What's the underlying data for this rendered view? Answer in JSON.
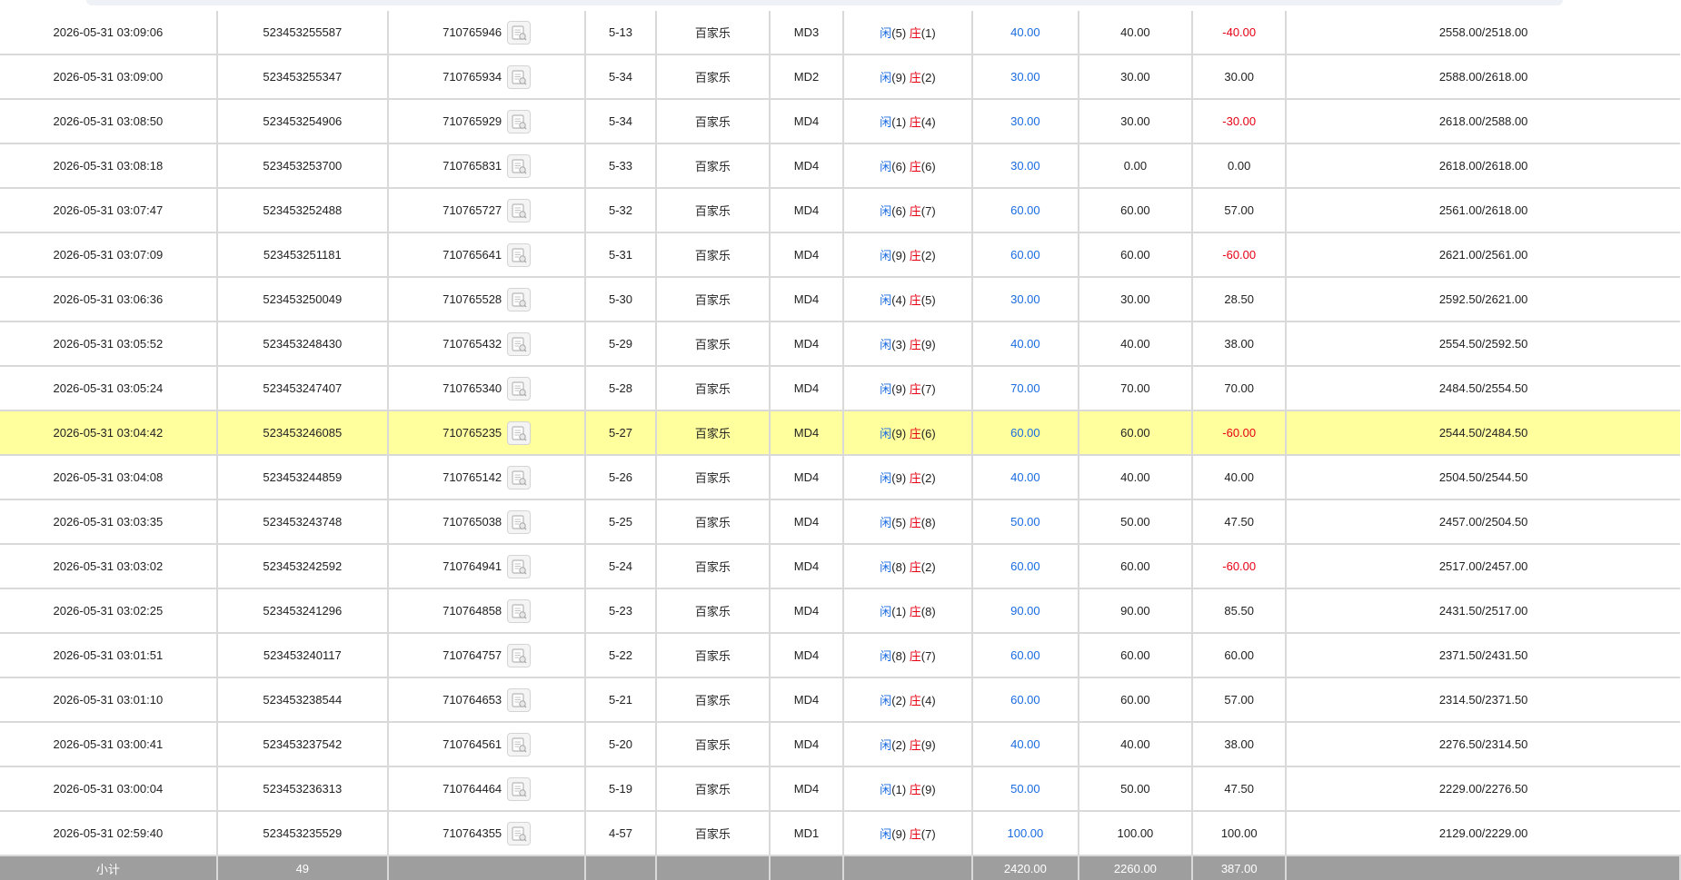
{
  "rows": [
    {
      "time": "2026-05-31 03:09:06",
      "order_no": "523453255587",
      "round_id": "710765946",
      "shoe": "5-13",
      "game": "百家乐",
      "table": "MD3",
      "xian_label": "闲",
      "xian_val": "(5)",
      "zhuang_label": "庄",
      "zhuang_val": "(1)",
      "bet": "40.00",
      "valid": "40.00",
      "win": "-40.00",
      "balance": "2558.00/2518.00",
      "win_negative": true
    },
    {
      "time": "2026-05-31 03:09:00",
      "order_no": "523453255347",
      "round_id": "710765934",
      "shoe": "5-34",
      "game": "百家乐",
      "table": "MD2",
      "xian_label": "闲",
      "xian_val": "(9)",
      "zhuang_label": "庄",
      "zhuang_val": "(2)",
      "bet": "30.00",
      "valid": "30.00",
      "win": "30.00",
      "balance": "2588.00/2618.00",
      "win_negative": false
    },
    {
      "time": "2026-05-31 03:08:50",
      "order_no": "523453254906",
      "round_id": "710765929",
      "shoe": "5-34",
      "game": "百家乐",
      "table": "MD4",
      "xian_label": "闲",
      "xian_val": "(1)",
      "zhuang_label": "庄",
      "zhuang_val": "(4)",
      "bet": "30.00",
      "valid": "30.00",
      "win": "-30.00",
      "balance": "2618.00/2588.00",
      "win_negative": true
    },
    {
      "time": "2026-05-31 03:08:18",
      "order_no": "523453253700",
      "round_id": "710765831",
      "shoe": "5-33",
      "game": "百家乐",
      "table": "MD4",
      "xian_label": "闲",
      "xian_val": "(6)",
      "zhuang_label": "庄",
      "zhuang_val": "(6)",
      "bet": "30.00",
      "valid": "0.00",
      "win": "0.00",
      "balance": "2618.00/2618.00",
      "win_negative": false
    },
    {
      "time": "2026-05-31 03:07:47",
      "order_no": "523453252488",
      "round_id": "710765727",
      "shoe": "5-32",
      "game": "百家乐",
      "table": "MD4",
      "xian_label": "闲",
      "xian_val": "(6)",
      "zhuang_label": "庄",
      "zhuang_val": "(7)",
      "bet": "60.00",
      "valid": "60.00",
      "win": "57.00",
      "balance": "2561.00/2618.00",
      "win_negative": false
    },
    {
      "time": "2026-05-31 03:07:09",
      "order_no": "523453251181",
      "round_id": "710765641",
      "shoe": "5-31",
      "game": "百家乐",
      "table": "MD4",
      "xian_label": "闲",
      "xian_val": "(9)",
      "zhuang_label": "庄",
      "zhuang_val": "(2)",
      "bet": "60.00",
      "valid": "60.00",
      "win": "-60.00",
      "balance": "2621.00/2561.00",
      "win_negative": true
    },
    {
      "time": "2026-05-31 03:06:36",
      "order_no": "523453250049",
      "round_id": "710765528",
      "shoe": "5-30",
      "game": "百家乐",
      "table": "MD4",
      "xian_label": "闲",
      "xian_val": "(4)",
      "zhuang_label": "庄",
      "zhuang_val": "(5)",
      "bet": "30.00",
      "valid": "30.00",
      "win": "28.50",
      "balance": "2592.50/2621.00",
      "win_negative": false
    },
    {
      "time": "2026-05-31 03:05:52",
      "order_no": "523453248430",
      "round_id": "710765432",
      "shoe": "5-29",
      "game": "百家乐",
      "table": "MD4",
      "xian_label": "闲",
      "xian_val": "(3)",
      "zhuang_label": "庄",
      "zhuang_val": "(9)",
      "bet": "40.00",
      "valid": "40.00",
      "win": "38.00",
      "balance": "2554.50/2592.50",
      "win_negative": false
    },
    {
      "time": "2026-05-31 03:05:24",
      "order_no": "523453247407",
      "round_id": "710765340",
      "shoe": "5-28",
      "game": "百家乐",
      "table": "MD4",
      "xian_label": "闲",
      "xian_val": "(9)",
      "zhuang_label": "庄",
      "zhuang_val": "(7)",
      "bet": "70.00",
      "valid": "70.00",
      "win": "70.00",
      "balance": "2484.50/2554.50",
      "win_negative": false
    },
    {
      "time": "2026-05-31 03:04:42",
      "order_no": "523453246085",
      "round_id": "710765235",
      "shoe": "5-27",
      "game": "百家乐",
      "table": "MD4",
      "xian_label": "闲",
      "xian_val": "(9)",
      "zhuang_label": "庄",
      "zhuang_val": "(6)",
      "bet": "60.00",
      "valid": "60.00",
      "win": "-60.00",
      "balance": "2544.50/2484.50",
      "win_negative": true,
      "highlighted": true
    },
    {
      "time": "2026-05-31 03:04:08",
      "order_no": "523453244859",
      "round_id": "710765142",
      "shoe": "5-26",
      "game": "百家乐",
      "table": "MD4",
      "xian_label": "闲",
      "xian_val": "(9)",
      "zhuang_label": "庄",
      "zhuang_val": "(2)",
      "bet": "40.00",
      "valid": "40.00",
      "win": "40.00",
      "balance": "2504.50/2544.50",
      "win_negative": false
    },
    {
      "time": "2026-05-31 03:03:35",
      "order_no": "523453243748",
      "round_id": "710765038",
      "shoe": "5-25",
      "game": "百家乐",
      "table": "MD4",
      "xian_label": "闲",
      "xian_val": "(5)",
      "zhuang_label": "庄",
      "zhuang_val": "(8)",
      "bet": "50.00",
      "valid": "50.00",
      "win": "47.50",
      "balance": "2457.00/2504.50",
      "win_negative": false
    },
    {
      "time": "2026-05-31 03:03:02",
      "order_no": "523453242592",
      "round_id": "710764941",
      "shoe": "5-24",
      "game": "百家乐",
      "table": "MD4",
      "xian_label": "闲",
      "xian_val": "(8)",
      "zhuang_label": "庄",
      "zhuang_val": "(2)",
      "bet": "60.00",
      "valid": "60.00",
      "win": "-60.00",
      "balance": "2517.00/2457.00",
      "win_negative": true
    },
    {
      "time": "2026-05-31 03:02:25",
      "order_no": "523453241296",
      "round_id": "710764858",
      "shoe": "5-23",
      "game": "百家乐",
      "table": "MD4",
      "xian_label": "闲",
      "xian_val": "(1)",
      "zhuang_label": "庄",
      "zhuang_val": "(8)",
      "bet": "90.00",
      "valid": "90.00",
      "win": "85.50",
      "balance": "2431.50/2517.00",
      "win_negative": false
    },
    {
      "time": "2026-05-31 03:01:51",
      "order_no": "523453240117",
      "round_id": "710764757",
      "shoe": "5-22",
      "game": "百家乐",
      "table": "MD4",
      "xian_label": "闲",
      "xian_val": "(8)",
      "zhuang_label": "庄",
      "zhuang_val": "(7)",
      "bet": "60.00",
      "valid": "60.00",
      "win": "60.00",
      "balance": "2371.50/2431.50",
      "win_negative": false
    },
    {
      "time": "2026-05-31 03:01:10",
      "order_no": "523453238544",
      "round_id": "710764653",
      "shoe": "5-21",
      "game": "百家乐",
      "table": "MD4",
      "xian_label": "闲",
      "xian_val": "(2)",
      "zhuang_label": "庄",
      "zhuang_val": "(4)",
      "bet": "60.00",
      "valid": "60.00",
      "win": "57.00",
      "balance": "2314.50/2371.50",
      "win_negative": false
    },
    {
      "time": "2026-05-31 03:00:41",
      "order_no": "523453237542",
      "round_id": "710764561",
      "shoe": "5-20",
      "game": "百家乐",
      "table": "MD4",
      "xian_label": "闲",
      "xian_val": "(2)",
      "zhuang_label": "庄",
      "zhuang_val": "(9)",
      "bet": "40.00",
      "valid": "40.00",
      "win": "38.00",
      "balance": "2276.50/2314.50",
      "win_negative": false
    },
    {
      "time": "2026-05-31 03:00:04",
      "order_no": "523453236313",
      "round_id": "710764464",
      "shoe": "5-19",
      "game": "百家乐",
      "table": "MD4",
      "xian_label": "闲",
      "xian_val": "(1)",
      "zhuang_label": "庄",
      "zhuang_val": "(9)",
      "bet": "50.00",
      "valid": "50.00",
      "win": "47.50",
      "balance": "2229.00/2276.50",
      "win_negative": false
    },
    {
      "time": "2026-05-31 02:59:40",
      "order_no": "523453235529",
      "round_id": "710764355",
      "shoe": "4-57",
      "game": "百家乐",
      "table": "MD1",
      "xian_label": "闲",
      "xian_val": "(9)",
      "zhuang_label": "庄",
      "zhuang_val": "(7)",
      "bet": "100.00",
      "valid": "100.00",
      "win": "100.00",
      "balance": "2129.00/2229.00",
      "win_negative": false
    }
  ],
  "subtotal": {
    "label": "小计",
    "count": "49",
    "bet": "2420.00",
    "valid": "2260.00",
    "win": "387.00"
  },
  "icons": {
    "round_detail": "detail-doc-icon"
  },
  "colors": {
    "bet_blue": "#1a6be0",
    "negative_red": "#e60012",
    "highlight_row": "#ffff9e",
    "subtotal_bg": "#9e9e9e"
  }
}
